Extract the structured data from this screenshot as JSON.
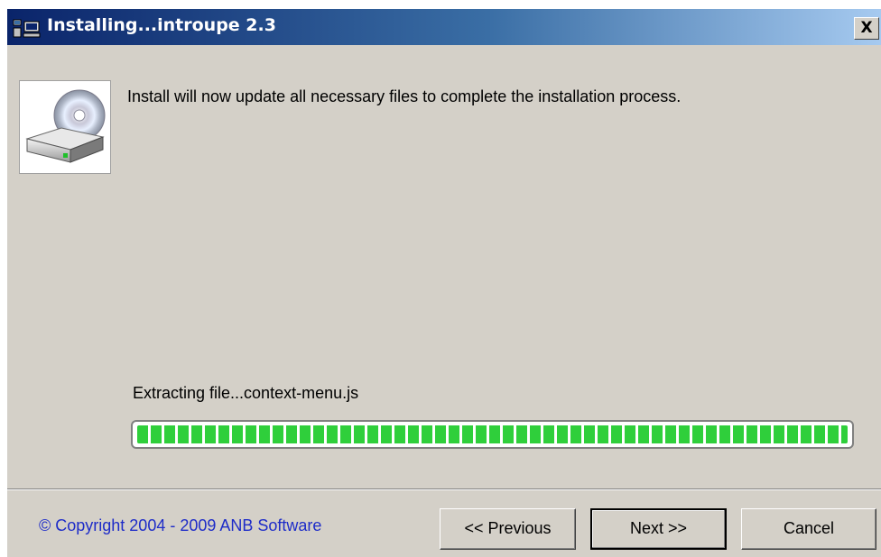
{
  "window": {
    "title": "Installing...introupe 2.3",
    "close_label": "X"
  },
  "icons": {
    "app": "computer-network-icon",
    "disc": "cd-drive-icon"
  },
  "main": {
    "message": "Install will now update all necessary files to complete the installation process.",
    "progress_status": "Extracting file...context-menu.js",
    "progress_percent": 100
  },
  "footer": {
    "copyright": "© Copyright 2004 - 2009 ANB Software",
    "previous_label": "<< Previous",
    "next_label": "Next >>",
    "cancel_label": "Cancel"
  },
  "colors": {
    "title_bar_start": "#0a246a",
    "title_bar_end": "#a6caf0",
    "dialog_face": "#d4d0c8",
    "progress_green": "#2fcf3b",
    "copyright_blue": "#1e2cc8"
  }
}
